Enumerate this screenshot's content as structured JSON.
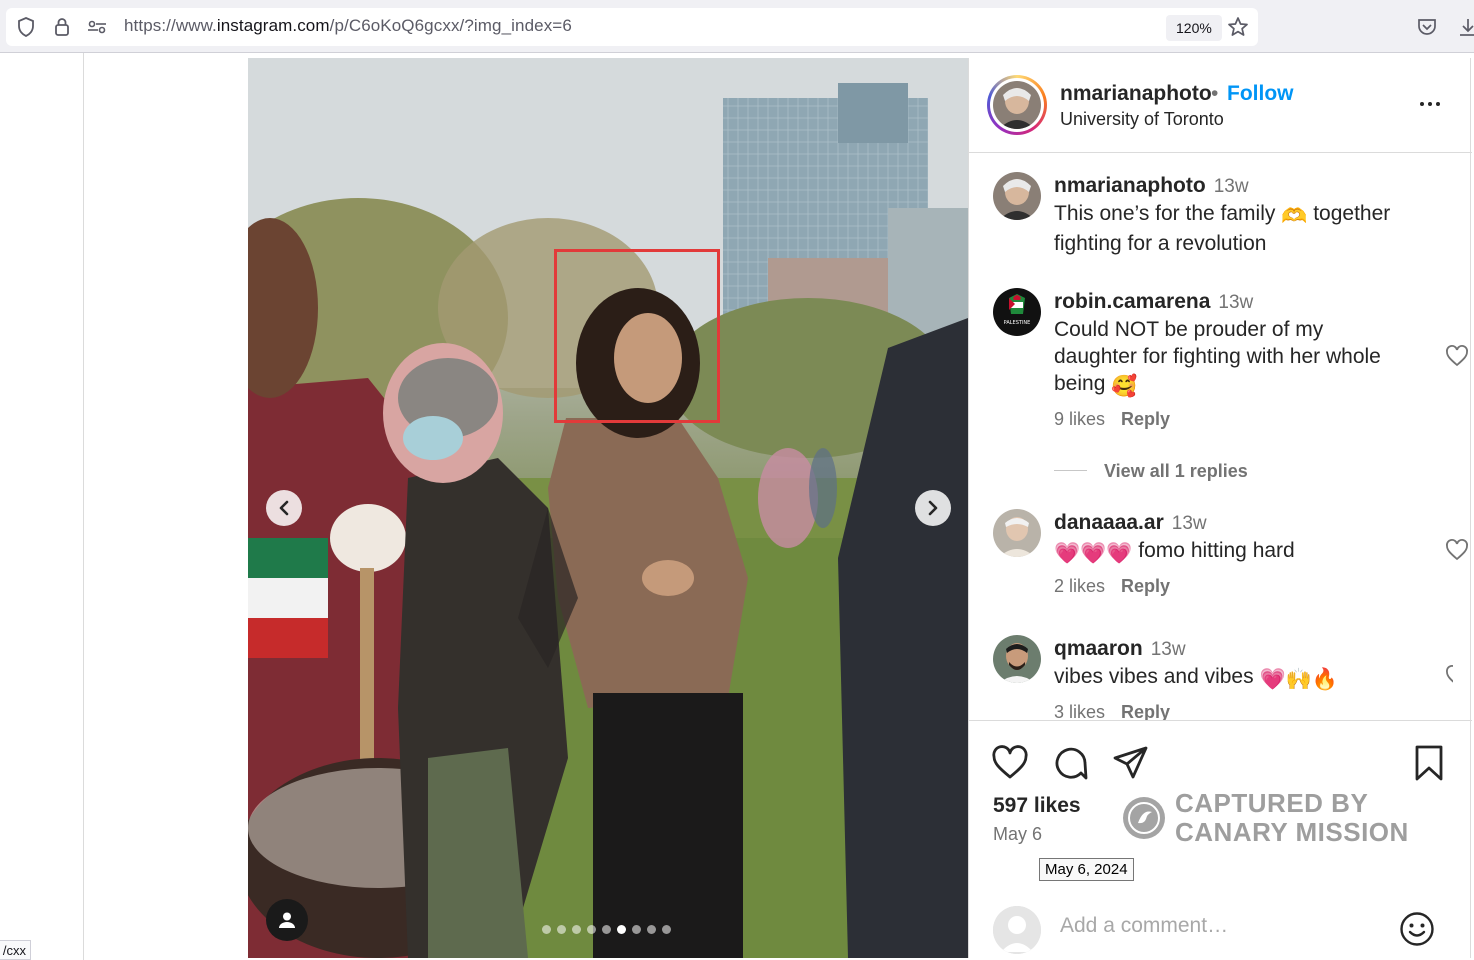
{
  "browser": {
    "url_prefix": "https://www.",
    "url_domain": "instagram.com",
    "url_path": "/p/C6oKoQ6gcxx/?img_index=6",
    "zoom": "120%",
    "status_url": "cxx/"
  },
  "post": {
    "username": "nmarianaphoto",
    "separator": "•",
    "follow_label": "Follow",
    "location": "University of Toronto",
    "carousel": {
      "slide_count": 9,
      "active_index": 5
    }
  },
  "comments": [
    {
      "username": "nmarianaphoto",
      "time": "13w",
      "text_a": "This one’s for the family",
      "emoji": "🫶",
      "text_b": "together fighting for a revolution"
    },
    {
      "username": "robin.camarena",
      "time": "13w",
      "text": "Could NOT be prouder of my daughter for fighting with her whole being",
      "emoji": "🥰",
      "likes": "9 likes",
      "reply": "Reply",
      "avatar_caption": "PALESTINE"
    },
    {
      "username": "danaaaa.ar",
      "time": "13w",
      "emoji": "💗💗💗",
      "text": "fomo hitting hard",
      "likes": "2 likes",
      "reply": "Reply"
    },
    {
      "username": "qmaaron",
      "time": "13w",
      "text": "vibes vibes and vibes",
      "emoji": "💗🙌🔥",
      "likes": "3 likes",
      "reply": "Reply"
    }
  ],
  "view_replies": "View all 1 replies",
  "footer": {
    "likes": "597 likes",
    "date": "May 6",
    "date_tooltip": "May 6, 2024",
    "comment_placeholder": "Add a comment…"
  },
  "watermark": {
    "line1": "CAPTURED BY",
    "line2": "CANARY MISSION"
  }
}
